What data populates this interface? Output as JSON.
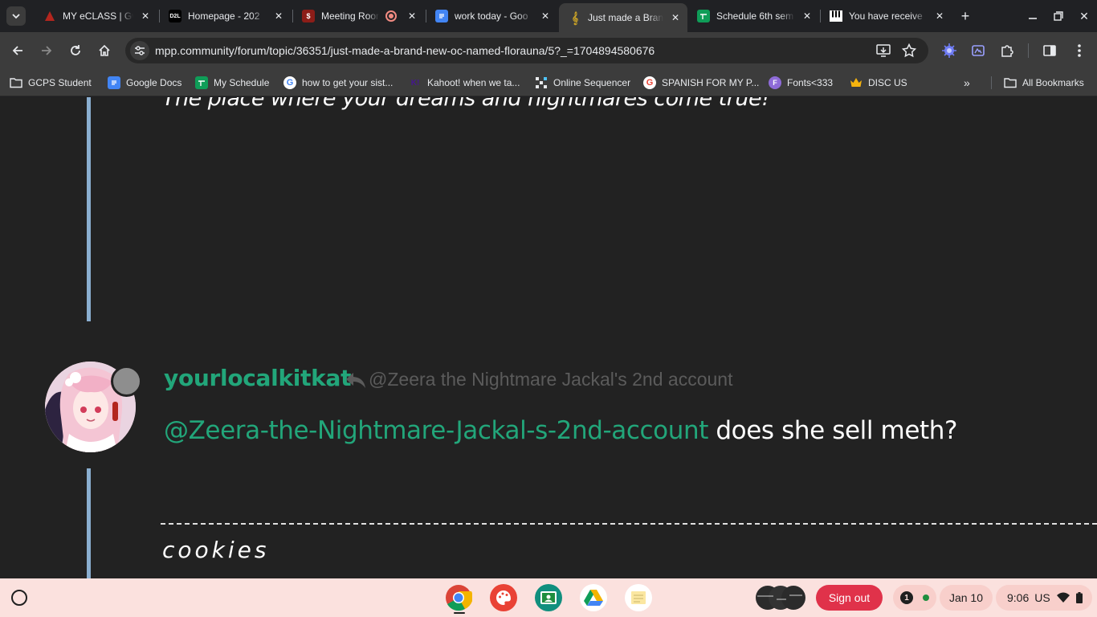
{
  "browser": {
    "tabs": [
      {
        "title": "MY eCLASS | Gwi",
        "favicon": "eclass-icon",
        "color": "#b3261e"
      },
      {
        "title": "Homepage - 202",
        "favicon": "d2l-icon",
        "color": "#000000"
      },
      {
        "title": "Meeting Room",
        "favicon": "meeting-icon",
        "color": "#8c1d18"
      },
      {
        "title": "work today - Goo",
        "favicon": "docs-icon",
        "color": "#4285f4"
      },
      {
        "title": "Just made a Bran",
        "favicon": "music-note-icon",
        "color": "#c9a227"
      },
      {
        "title": "Schedule 6th sem",
        "favicon": "sheets-icon",
        "color": "#0f9d58"
      },
      {
        "title": "You have receive",
        "favicon": "piano-icon",
        "color": "#e8eaed"
      }
    ],
    "active_tab_index": 4,
    "url": "mpp.community/forum/topic/36351/just-made-a-brand-new-oc-named-florauna/5?_=1704894580676"
  },
  "bookmarks": [
    {
      "label": "GCPS Student",
      "icon": "folder-icon"
    },
    {
      "label": "Google Docs",
      "icon": "docs-icon"
    },
    {
      "label": "My Schedule",
      "icon": "sheets-icon"
    },
    {
      "label": "how to get your sist...",
      "icon": "google-icon"
    },
    {
      "label": "Kahoot! when we ta...",
      "icon": "kahoot-icon"
    },
    {
      "label": "Online Sequencer",
      "icon": "sequencer-icon"
    },
    {
      "label": "SPANISH FOR MY P...",
      "icon": "google-icon"
    },
    {
      "label": "Fonts<333",
      "icon": "fonts-icon"
    },
    {
      "label": "DISC US",
      "icon": "crown-icon"
    }
  ],
  "all_bookmarks_label": "All Bookmarks",
  "page": {
    "tagline": "The place where your dreams and nightmares come true!",
    "post": {
      "username": "yourlocalkitkat",
      "reply_to": "@Zeera the Nightmare Jackal's 2nd account",
      "mention": "@Zeera-the-Nightmare-Jackal-s-2nd-account",
      "body": " does she sell meth?",
      "signature": "cookies"
    }
  },
  "shelf": {
    "apps": [
      "chrome-icon",
      "canvas-paint-icon",
      "classroom-icon",
      "drive-icon",
      "keep-icon"
    ],
    "sign_out_label": "Sign out",
    "notification_count": "1",
    "date": "Jan 10",
    "time": "9:06",
    "locale": "US"
  },
  "colors": {
    "accent_green": "#22a67a",
    "thread_line": "#8aaed0",
    "signout_red": "#e0324a",
    "shelf_bg": "#fbe1de"
  }
}
